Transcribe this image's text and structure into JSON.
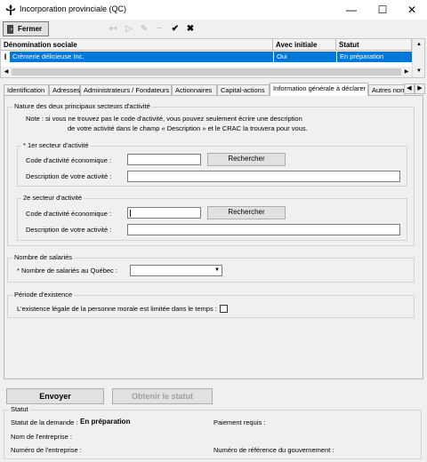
{
  "window": {
    "title": "Incorporation provinciale (QC)"
  },
  "toolbar": {
    "close_label": "Fermer"
  },
  "grid": {
    "columns": [
      "Dénomination sociale",
      "Avec initiale",
      "Statut"
    ],
    "rows": [
      {
        "name": "Crèmerie délicieuse Inc.",
        "initial": "Oui",
        "status": "En préparation"
      }
    ]
  },
  "tabs": [
    "Identification",
    "Adresses",
    "Administrateurs / Fondateurs",
    "Actionnaires",
    "Capital-actions",
    "Information générale à déclarer",
    "Autres nom"
  ],
  "form": {
    "sectors_group": "Nature des deux principaux secteurs d'activité",
    "note_1": "Note :  si vous ne trouvez pas le code d'activité, vous pouvez seulement écrire une description",
    "note_2": "de votre activité dans le champ « Description » et le CRAC la trouvera pour vous.",
    "sector1_group": "* 1er secteur d'activité",
    "sector2_group": "2e secteur d'activité",
    "code_label": "Code d'activité économique :",
    "desc_label": "Description de votre activité :",
    "search_label": "Rechercher",
    "employees_group": "Nombre de salariés",
    "employees_label": "* Nombre de salariés au Québec :",
    "existence_group": "Période d'existence",
    "existence_label": "L'existence légale de la personne morale est limitée dans le temps :"
  },
  "actions": {
    "send": "Envoyer",
    "get_status": "Obtenir le statut"
  },
  "status": {
    "group": "Statut",
    "request_status_label": "Statut de la demande :",
    "request_status_value": "En préparation",
    "payment_label": "Paiement requis :",
    "company_name_label": "Nom de l'entreprise :",
    "company_number_label": "Numéro de l'entreprise :",
    "gov_ref_label": "Numéro de référence du gouvernement :"
  }
}
